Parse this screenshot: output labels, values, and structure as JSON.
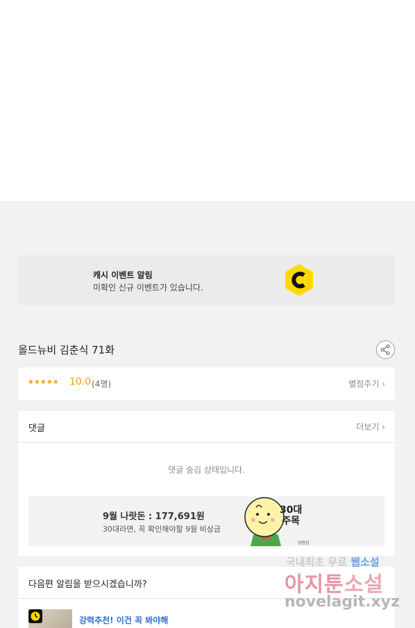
{
  "cash_event": {
    "title": "캐시 이벤트 알림",
    "subtitle": "미확인 신규 이벤트가 있습니다.",
    "logo_icon": "coin-c-icon",
    "logo_color": "#ffd900"
  },
  "episode": {
    "title": "올드뉴비 김춘식 71화",
    "share_icon": "share-icon"
  },
  "rating": {
    "stars": "★★★★★",
    "score": "10.0",
    "count": "(4명)",
    "give_label": "별점주기 ›",
    "accent": "#f4a300"
  },
  "comments": {
    "title": "댓글",
    "more_label": "더보기 ›",
    "hidden_message": "댓글 숨김 상태입니다."
  },
  "ad": {
    "title": "9월 나랏돈 : 177,691원",
    "subtitle": "30대라면, 꼭 확인해야할 9월 비상금",
    "badge_line1": "30대",
    "badge_line2": "주목",
    "small_text": "삼점삼"
  },
  "alarm": {
    "title": "다음편 알림을 받으시겠습니까?",
    "recommend_label": "강력추천! 이건 꼭 봐야해",
    "recommend_color": "#2f6ed1"
  },
  "watermark": {
    "line1a": "국내최초 무료",
    "line1b": "웹소설",
    "line2a": "아지툰",
    "line2b": "소설",
    "line3": "novelagit.xyz"
  }
}
